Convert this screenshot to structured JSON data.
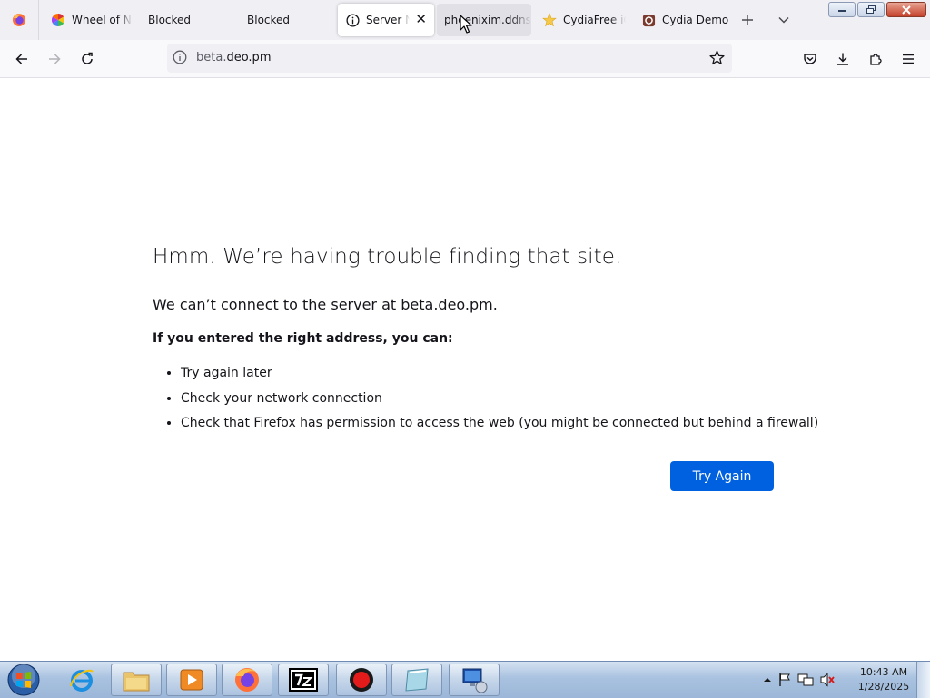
{
  "browser": {
    "tabs": [
      {
        "label": "Wheel of Na",
        "icon": "colorful-wheel-icon"
      },
      {
        "label": "Blocked",
        "icon": ""
      },
      {
        "label": "Blocked",
        "icon": ""
      },
      {
        "label": "Server No",
        "icon": "info-icon",
        "active": true
      },
      {
        "label": "phoenixim.ddns.",
        "icon": "",
        "hovered": true
      },
      {
        "label": "CydiaFree iC",
        "icon": "star-icon"
      },
      {
        "label": "Cydia Demo",
        "icon": "cydia-icon"
      }
    ],
    "url": {
      "host": "beta.",
      "domain": "deo.pm"
    }
  },
  "error_page": {
    "title": "Hmm. We’re having trouble finding that site.",
    "subtitle": "We can’t connect to the server at beta.deo.pm.",
    "hint_heading": "If you entered the right address, you can:",
    "suggestions": [
      "Try again later",
      "Check your network connection",
      "Check that Firefox has permission to access the web (you might be connected but behind a firewall)"
    ],
    "try_again_label": "Try Again"
  },
  "taskbar": {
    "clock_time": "10:43 AM",
    "clock_date": "1/28/2025",
    "apps": [
      "internet-explorer-icon",
      "file-explorer-icon",
      "media-player-icon",
      "firefox-icon",
      "7zip-icon",
      "record-icon",
      "notepad-icon",
      "network-app-icon"
    ]
  },
  "colors": {
    "accent": "#0061e0",
    "tabstrip_bg": "#f0f0f4",
    "text": "#15141a"
  }
}
